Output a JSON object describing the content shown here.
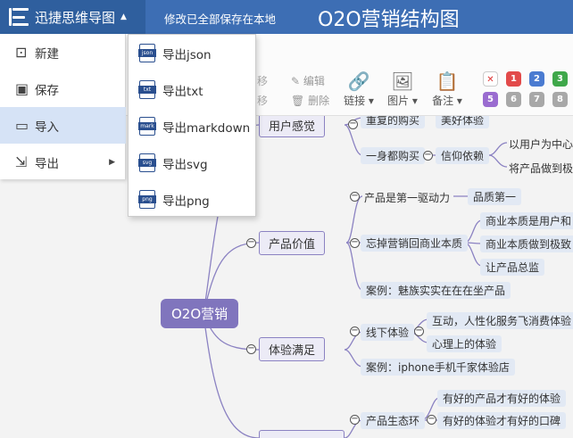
{
  "header": {
    "app_title": "迅捷思维导图",
    "save_status": "修改已全部保存在本地",
    "doc_title": "O2O营销结构图"
  },
  "main_menu": {
    "items": [
      {
        "label": "新建",
        "icon": "new-file-icon"
      },
      {
        "label": "保存",
        "icon": "save-icon"
      },
      {
        "label": "导入",
        "icon": "folder-open-icon"
      },
      {
        "label": "导出",
        "icon": "export-icon"
      }
    ]
  },
  "export_submenu": {
    "items": [
      {
        "label": "导出json",
        "icon_text": "json"
      },
      {
        "label": "导出txt",
        "icon_text": "txt"
      },
      {
        "label": "导出markdown",
        "icon_text": "mark"
      },
      {
        "label": "导出svg",
        "icon_text": "svg"
      },
      {
        "label": "导出png",
        "icon_text": "png"
      }
    ]
  },
  "toolbar": {
    "move_up": "移",
    "move_down": "移",
    "edit": "编辑",
    "delete": "删除",
    "link": "链接",
    "image": "图片",
    "note": "备注",
    "priorities": [
      "1",
      "2",
      "3",
      "5",
      "6",
      "7",
      "8"
    ]
  },
  "mindmap": {
    "root": "O2O营销",
    "branches": {
      "user_feeling": "用户感觉",
      "product_value": "产品价值",
      "experience": "体验满足"
    },
    "nodes": {
      "repeat_purchase": "重复的购买",
      "good_exp": "美好体验",
      "all_purchase": "一身都购买",
      "trust": "信仰依赖",
      "user_center": "以用户为中心",
      "product_best": "将产品做到极",
      "product_first": "产品是第一驱动力",
      "quality_first": "品质第一",
      "forget_marketing": "忘掉营销回商业本质",
      "biz_essence1": "商业本质是用户和",
      "biz_essence2": "商业本质做到极致",
      "product_sells": "让产品总监",
      "case1": "案例：魅族实实在在在坐产品",
      "offline_exp": "线下体验",
      "interact": "互动，人性化服务飞消费体验",
      "psych_exp": "心理上的体验",
      "case2": "案例：iphone手机千家体验店",
      "ecosystem": "产品生态环",
      "good_product": "有好的产品才有好的体验",
      "good_exp_word": "有好的体验才有好的口碑"
    }
  },
  "colors": {
    "topbar": "#3d6eb4",
    "brand": "#2f5f9e",
    "root": "#8075bd",
    "branch_border": "#8b82c2",
    "leaf_bg": "#e2e9f4",
    "prio_red": "#e24a4a",
    "prio_blue": "#4a7bd1",
    "prio_green": "#3fa84a",
    "prio_purple": "#9a6cd0",
    "prio_gray": "#a8a8a8"
  }
}
